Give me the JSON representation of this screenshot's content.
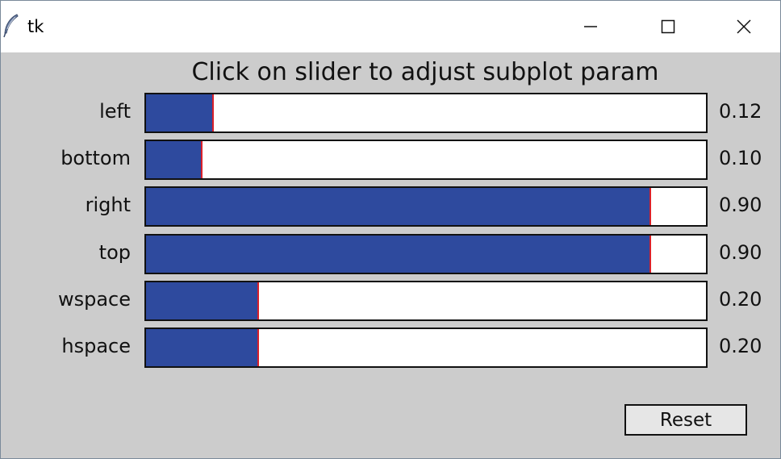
{
  "window": {
    "title": "tk",
    "icons": {
      "app": "feather-icon",
      "minimize": "minimize-icon",
      "maximize": "maximize-icon",
      "close": "close-icon"
    }
  },
  "heading": "Click on slider to adjust subplot param",
  "sliders": [
    {
      "label": "left",
      "value": 0.12,
      "value_text": "0.12",
      "min": 0,
      "max": 1
    },
    {
      "label": "bottom",
      "value": 0.1,
      "value_text": "0.10",
      "min": 0,
      "max": 1
    },
    {
      "label": "right",
      "value": 0.9,
      "value_text": "0.90",
      "min": 0,
      "max": 1
    },
    {
      "label": "top",
      "value": 0.9,
      "value_text": "0.90",
      "min": 0,
      "max": 1
    },
    {
      "label": "wspace",
      "value": 0.2,
      "value_text": "0.20",
      "min": 0,
      "max": 1
    },
    {
      "label": "hspace",
      "value": 0.2,
      "value_text": "0.20",
      "min": 0,
      "max": 1
    }
  ],
  "reset_label": "Reset",
  "colors": {
    "background": "#cccccc",
    "slider_fill": "#2e4a9e",
    "slider_handle": "#d9202a",
    "track": "#ffffff"
  }
}
